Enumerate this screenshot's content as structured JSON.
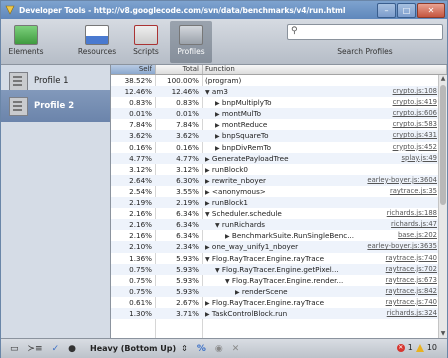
{
  "window": {
    "title": "Developer Tools - http://v8.googlecode.com/svn/data/benchmarks/v4/run.html"
  },
  "window_buttons": {
    "minimize": "–",
    "maximize": "□",
    "close": "✕"
  },
  "toolbar": {
    "tools": [
      {
        "label": "Elements",
        "icon": "elements-icon",
        "color": "#4aa64a"
      },
      {
        "label": "Resources",
        "icon": "resources-icon",
        "color": "#4a7ad0"
      },
      {
        "label": "Scripts",
        "icon": "scripts-icon",
        "color": "#c8403a"
      },
      {
        "label": "Profiles",
        "icon": "profiles-icon",
        "color": "#8f98a3"
      }
    ],
    "search_label": "Search Profiles"
  },
  "sidebar": {
    "profiles": [
      "Profile 1",
      "Profile 2"
    ],
    "selected_index": 1
  },
  "grid": {
    "headers": {
      "self": "Self",
      "total": "Total",
      "function": "Function"
    },
    "rows": [
      {
        "self": "38.52%",
        "total": "100.00%",
        "fn": "(program)",
        "arrow": "",
        "indent": 0,
        "link": ""
      },
      {
        "self": "12.46%",
        "total": "12.46%",
        "fn": "am3",
        "arrow": "▼",
        "indent": 0,
        "link": "crypto.js:108"
      },
      {
        "self": "0.83%",
        "total": "0.83%",
        "fn": "bnpMultiplyTo",
        "arrow": "▶",
        "indent": 1,
        "link": "crypto.js:419"
      },
      {
        "self": "0.01%",
        "total": "0.01%",
        "fn": "montMulTo",
        "arrow": "▶",
        "indent": 1,
        "link": "crypto.js:606"
      },
      {
        "self": "7.84%",
        "total": "7.84%",
        "fn": "montReduce",
        "arrow": "▶",
        "indent": 1,
        "link": "crypto.js:583"
      },
      {
        "self": "3.62%",
        "total": "3.62%",
        "fn": "bnpSquareTo",
        "arrow": "▶",
        "indent": 1,
        "link": "crypto.js:431"
      },
      {
        "self": "0.16%",
        "total": "0.16%",
        "fn": "bnpDivRemTo",
        "arrow": "▶",
        "indent": 1,
        "link": "crypto.js:452"
      },
      {
        "self": "4.77%",
        "total": "4.77%",
        "fn": "GeneratePayloadTree",
        "arrow": "▶",
        "indent": 0,
        "link": "splay.js:49"
      },
      {
        "self": "3.12%",
        "total": "3.12%",
        "fn": "runBlock0",
        "arrow": "▶",
        "indent": 0,
        "link": ""
      },
      {
        "self": "2.64%",
        "total": "6.30%",
        "fn": "rewrite_nboyer",
        "arrow": "▶",
        "indent": 0,
        "link": "earley-boyer.js:3604"
      },
      {
        "self": "2.54%",
        "total": "3.55%",
        "fn": "<anonymous>",
        "arrow": "▶",
        "indent": 0,
        "link": "raytrace.js:35"
      },
      {
        "self": "2.19%",
        "total": "2.19%",
        "fn": "runBlock1",
        "arrow": "▶",
        "indent": 0,
        "link": ""
      },
      {
        "self": "2.16%",
        "total": "6.34%",
        "fn": "Scheduler.schedule",
        "arrow": "▼",
        "indent": 0,
        "link": "richards.js:188"
      },
      {
        "self": "2.16%",
        "total": "6.34%",
        "fn": "runRichards",
        "arrow": "▼",
        "indent": 1,
        "link": "richards.js:47"
      },
      {
        "self": "2.16%",
        "total": "6.34%",
        "fn": "BenchmarkSuite.RunSingleBenc...",
        "arrow": "▶",
        "indent": 2,
        "link": "base.js:202"
      },
      {
        "self": "2.10%",
        "total": "2.34%",
        "fn": "one_way_unify1_nboyer",
        "arrow": "▶",
        "indent": 0,
        "link": "earley-boyer.js:3635"
      },
      {
        "self": "1.36%",
        "total": "5.93%",
        "fn": "Flog.RayTracer.Engine.rayTrace",
        "arrow": "▼",
        "indent": 0,
        "link": "raytrace.js:740"
      },
      {
        "self": "0.75%",
        "total": "5.93%",
        "fn": "Flog.RayTracer.Engine.getPixel...",
        "arrow": "▼",
        "indent": 1,
        "link": "raytrace.js:702"
      },
      {
        "self": "0.75%",
        "total": "5.93%",
        "fn": "Flog.RayTracer.Engine.render...",
        "arrow": "▼",
        "indent": 2,
        "link": "raytrace.js:673"
      },
      {
        "self": "0.75%",
        "total": "5.93%",
        "fn": "renderScene",
        "arrow": "▶",
        "indent": 3,
        "link": "raytrace.js:842"
      },
      {
        "self": "0.61%",
        "total": "2.67%",
        "fn": "Flog.RayTracer.Engine.rayTrace",
        "arrow": "▶",
        "indent": 0,
        "link": "raytrace.js:740"
      },
      {
        "self": "1.30%",
        "total": "3.71%",
        "fn": "TaskControlBlock.run",
        "arrow": "▶",
        "indent": 0,
        "link": "richards.js:324"
      }
    ]
  },
  "statusbar": {
    "view_mode": "Heavy (Bottom Up)",
    "view_mode_updown": "⇕",
    "percent_toggle": "%",
    "error_count": "1",
    "warning_count": "10"
  }
}
